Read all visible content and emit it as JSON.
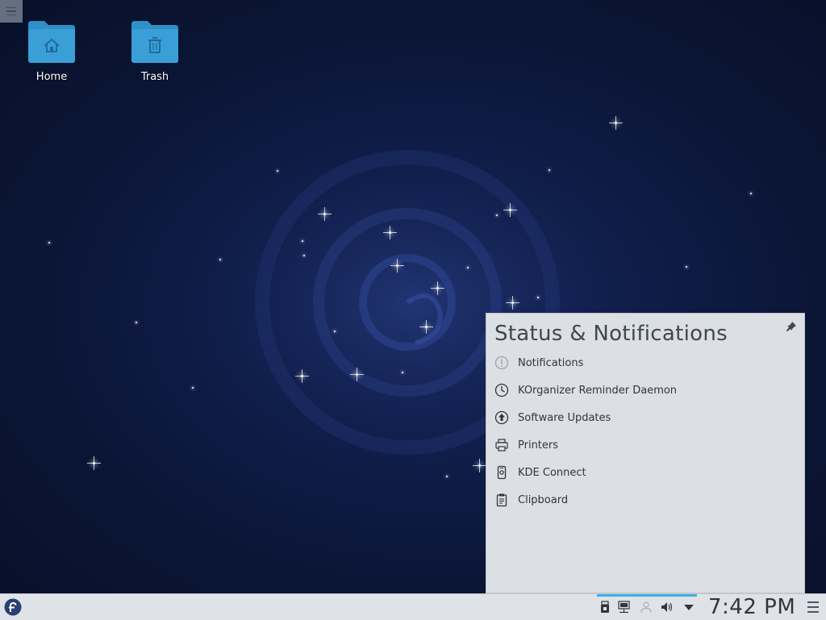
{
  "desktop": {
    "icons": [
      {
        "label": "Home",
        "icon": "home-folder-icon"
      },
      {
        "label": "Trash",
        "icon": "trash-folder-icon"
      }
    ]
  },
  "status_popup": {
    "title": "Status & Notifications",
    "items": [
      {
        "label": "Notifications",
        "icon": "notifications-icon"
      },
      {
        "label": "KOrganizer Reminder Daemon",
        "icon": "clock-icon"
      },
      {
        "label": "Software Updates",
        "icon": "software-updates-icon"
      },
      {
        "label": "Printers",
        "icon": "printer-icon"
      },
      {
        "label": "KDE Connect",
        "icon": "kde-connect-icon"
      },
      {
        "label": "Clipboard",
        "icon": "clipboard-icon"
      }
    ]
  },
  "panel": {
    "clock": "7:42 PM",
    "tray_icons": [
      "usb-device-icon",
      "network-icon",
      "user-icon",
      "volume-icon",
      "expand-arrow-icon"
    ]
  },
  "colors": {
    "accent": "#3daee9",
    "folder": "#3a9fd6",
    "panel_bg": "#dfe3e7",
    "popup_bg": "#dcdfe3"
  }
}
